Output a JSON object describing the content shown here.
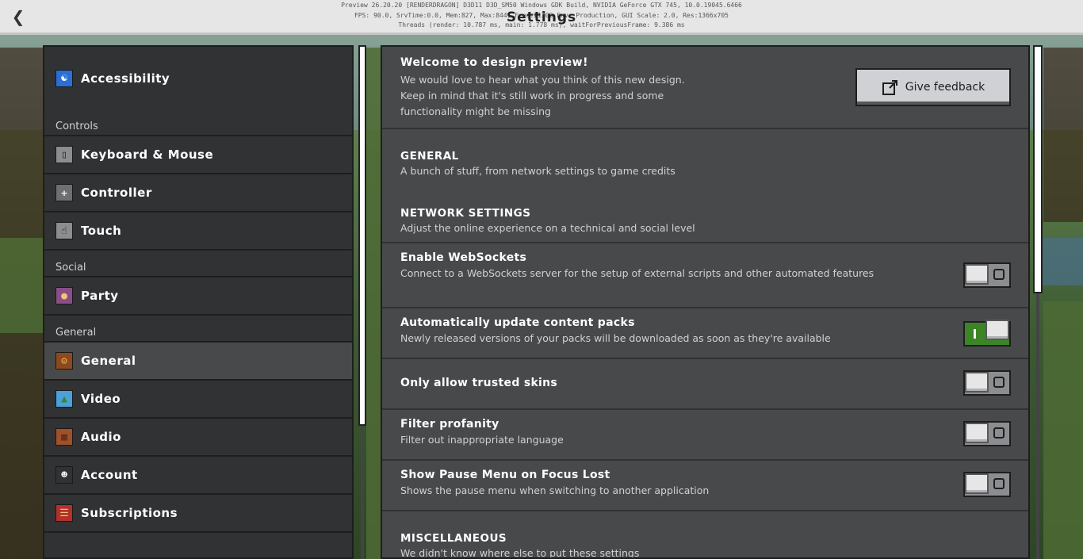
{
  "topbar": {
    "title": "Settings",
    "back_icon": "chevron-left-icon",
    "debug_lines": [
      "Preview 26.20.20 [RENDERDRAGON] D3D11 D3D_SM50 Windows GDK Build, NVIDIA GeForce GTX 745, 10.0.19045.6466",
      "FPS: 90.0, SrvTime:0.0, Mem:827, Max:844, Free:21300 Env: Production, GUI Scale: 2.0, Res:1366x705",
      "Threads (render: 10.787 ms, main: 1.778 ms), waitForPreviousFrame: 9.386 ms"
    ]
  },
  "sidebar": {
    "accessibility": {
      "label": "Accessibility",
      "icon": "accessibility-icon",
      "color": "#2b6fd6"
    },
    "controls_header": "Controls",
    "controls": [
      {
        "label": "Keyboard & Mouse",
        "icon": "mouse-icon",
        "color": "#8c8d90"
      },
      {
        "label": "Controller",
        "icon": "controller-icon",
        "color": "#6e6f71"
      },
      {
        "label": "Touch",
        "icon": "touch-icon",
        "color": "#8c8d90"
      }
    ],
    "social_header": "Social",
    "social": [
      {
        "label": "Party",
        "icon": "party-icon",
        "color": "#8a4e86"
      }
    ],
    "general_header": "General",
    "general": [
      {
        "label": "General",
        "icon": "gear-icon",
        "color": "#8b4a1e",
        "selected": true
      },
      {
        "label": "Video",
        "icon": "image-icon",
        "color": "#4aa0d8"
      },
      {
        "label": "Audio",
        "icon": "note-block-icon",
        "color": "#a0502a"
      },
      {
        "label": "Account",
        "icon": "account-icon",
        "color": "#313233"
      },
      {
        "label": "Subscriptions",
        "icon": "subscriptions-icon",
        "color": "#b2312a"
      }
    ]
  },
  "welcome": {
    "title": "Welcome to design preview!",
    "body": "We would love to hear what you think of this new design. Keep in mind that it's still work in progress and some functionality might be missing",
    "feedback_label": "Give feedback",
    "feedback_icon": "external-link-icon"
  },
  "sections": {
    "general": {
      "title": "GENERAL",
      "desc": "A bunch of stuff, from network settings to game credits"
    },
    "network": {
      "title": "NETWORK SETTINGS",
      "desc": "Adjust the online experience on a technical and social level"
    },
    "misc": {
      "title": "MISCELLANEOUS",
      "desc": "We didn't know where else to put these settings"
    }
  },
  "settings": [
    {
      "title": "Enable WebSockets",
      "desc": "Connect to a WebSockets server for the setup of external scripts and other automated features",
      "on": false
    },
    {
      "title": "Automatically update content packs",
      "desc": "Newly released versions of your packs will be downloaded as soon as they're available",
      "on": true
    },
    {
      "title": "Only allow trusted skins",
      "desc": "",
      "on": false
    },
    {
      "title": "Filter profanity",
      "desc": "Filter out inappropriate language",
      "on": false
    },
    {
      "title": "Show Pause Menu on Focus Lost",
      "desc": "Shows the pause menu when switching to another application",
      "on": false
    }
  ],
  "colors": {
    "accent_on": "#3c8527",
    "panel": "#48494a",
    "sidebar": "#313233"
  }
}
